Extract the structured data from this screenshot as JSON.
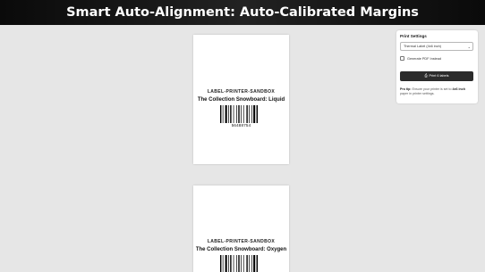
{
  "banner": {
    "title": "Smart Auto-Alignment: Auto-Calibrated Margins"
  },
  "labels": [
    {
      "store": "LABEL-PRINTER-SANDBOX",
      "product": "The Collection Snowboard: Liquid",
      "barcode": "56488754"
    },
    {
      "store": "LABEL-PRINTER-SANDBOX",
      "product": "The Collection Snowboard: Oxygen",
      "barcode": ""
    }
  ],
  "settings": {
    "title": "Print Settings",
    "label_type": "Thermal Label (4x6 inch)",
    "pdf_label": "Generate PDF Instead",
    "pdf_checked": false,
    "print_label": "Print 6 labels",
    "print_icon": "printer-icon",
    "tip_strong_1": "Pro tip:",
    "tip_text_1": " Ensure your printer is set to ",
    "tip_strong_2": "4x6 inch",
    "tip_text_2": " paper in printer settings."
  },
  "colors": {
    "banner_bg": "#111111",
    "print_button": "#2b2b2b",
    "page_bg": "#e6e6e6"
  }
}
